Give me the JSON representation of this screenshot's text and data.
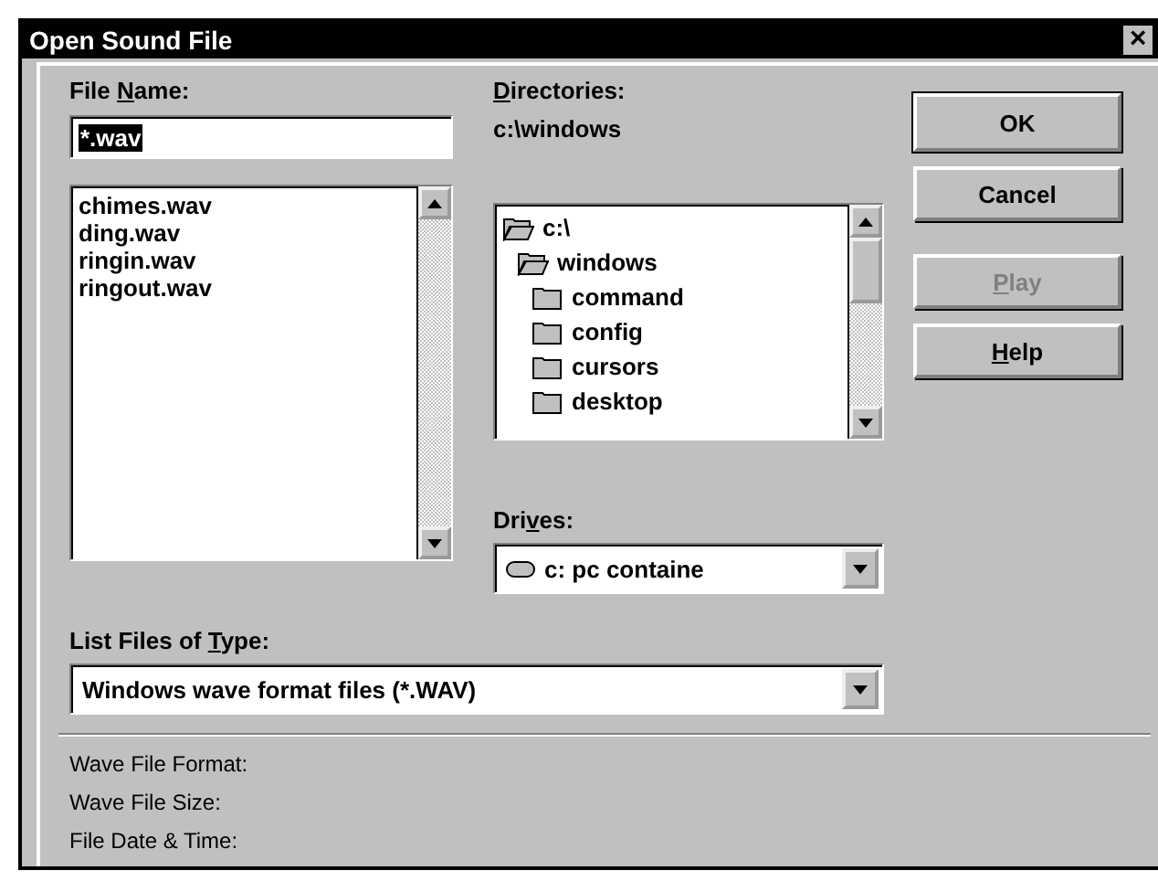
{
  "window": {
    "title": "Open Sound File",
    "close": "×"
  },
  "file_name": {
    "label": {
      "pre": "File ",
      "key": "N",
      "post": "ame:"
    },
    "value": "*.wav",
    "selected": true
  },
  "files": [
    {
      "name": "chimes.wav",
      "selected": false
    },
    {
      "name": "ding.wav",
      "selected": false
    },
    {
      "name": "ringin.wav",
      "selected": false
    },
    {
      "name": "ringout.wav",
      "selected": false
    }
  ],
  "directories": {
    "label": {
      "key": "D",
      "post": "irectories:"
    },
    "path": "c:\\windows",
    "tree": [
      {
        "name": "c:\\",
        "open": true,
        "children": [
          {
            "name": "windows",
            "open": true,
            "children": [
              {
                "name": "command",
                "open": false
              },
              {
                "name": "config",
                "open": false
              },
              {
                "name": "cursors",
                "open": false
              },
              {
                "name": "desktop",
                "open": false
              }
            ]
          }
        ]
      }
    ]
  },
  "drives": {
    "label": {
      "pre": "Dri",
      "key": "v",
      "post": "es:"
    },
    "value": "c: pc containe"
  },
  "file_type": {
    "label": {
      "pre": "List Files of ",
      "key": "T",
      "post": "ype:"
    },
    "value": "Windows wave format files (*.WAV)"
  },
  "buttons": [
    {
      "label": {
        "post": "OK"
      },
      "default": true,
      "disabled": false
    },
    {
      "label": {
        "post": "Cancel"
      },
      "default": false,
      "disabled": false
    },
    {
      "label": {
        "key": "P",
        "post": "lay"
      },
      "default": false,
      "disabled": true
    },
    {
      "label": {
        "key": "H",
        "post": "elp"
      },
      "default": false,
      "disabled": false
    }
  ],
  "info": [
    "Wave File Format:",
    "Wave File Size:",
    "File Date & Time:"
  ]
}
